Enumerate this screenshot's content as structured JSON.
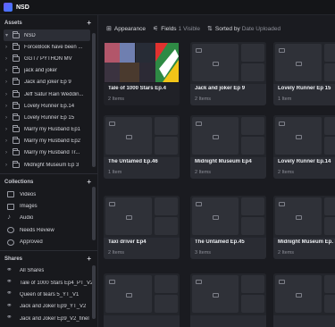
{
  "app": {
    "title": "NSD"
  },
  "assets": {
    "heading": "Assets",
    "items": [
      {
        "label": "NSD",
        "chevron": "▾",
        "active": true
      },
      {
        "label": "ForceBook have been ...",
        "chevron": "›"
      },
      {
        "label": "GGT7 PYTHON MV",
        "chevron": "›"
      },
      {
        "label": "jack and joker",
        "chevron": "›"
      },
      {
        "label": "Jack and joker Ep 9",
        "chevron": "›"
      },
      {
        "label": "Jeff Satur Rain Weddin...",
        "chevron": "›"
      },
      {
        "label": "Lovely Runner Ep.14",
        "chevron": "›"
      },
      {
        "label": "Lovely Runner Ep 15",
        "chevron": "›"
      },
      {
        "label": "Marry my Husband Ep1",
        "chevron": "›"
      },
      {
        "label": "Marry my Husband Ep2",
        "chevron": "›"
      },
      {
        "label": "Marry my Husband Tr...",
        "chevron": "›"
      },
      {
        "label": "Midnight Museum Ep 3",
        "chevron": "›"
      }
    ]
  },
  "collections": {
    "heading": "Collections",
    "items": [
      {
        "label": "Videos",
        "icon": "video-icon"
      },
      {
        "label": "Images",
        "icon": "image-icon"
      },
      {
        "label": "Audio",
        "icon": "audio-icon"
      },
      {
        "label": "Needs Review",
        "icon": "review-icon"
      },
      {
        "label": "Approved",
        "icon": "approved-icon"
      }
    ]
  },
  "shares": {
    "heading": "Shares",
    "items": [
      {
        "label": "All Shares"
      },
      {
        "label": "Tale of 1000 Stars Ep4_PT_V2"
      },
      {
        "label": "Queen of tears 5_YT_V1"
      },
      {
        "label": "Jack and Joker Ep9_YT_V2"
      },
      {
        "label": "Jack and Joker Ep9_V2_finel"
      }
    ]
  },
  "toolbar": {
    "appearance": "Appearance",
    "fields_label": "Fields",
    "fields_count": "1 Visible",
    "sorted_label": "Sorted by",
    "sorted_value": "Date Uploaded"
  },
  "cards": [
    {
      "name": "Tale of 1000 Stars Ep.4",
      "count": "2 Items",
      "kind": "image"
    },
    {
      "name": "Jack and joker Ep 9",
      "count": "2 Items",
      "kind": "folder"
    },
    {
      "name": "Lovely Runner Ep 15",
      "count": "1 Item",
      "kind": "folder"
    },
    {
      "name": "The Untamed Ep.46",
      "count": "1 Item",
      "kind": "folder"
    },
    {
      "name": "Midnight Museum Ep4",
      "count": "2 Items",
      "kind": "folder"
    },
    {
      "name": "Lovely Runner Ep.14",
      "count": "2 Items",
      "kind": "folder"
    },
    {
      "name": "Taxi driver Ep4",
      "count": "2 Items",
      "kind": "folder"
    },
    {
      "name": "The Untamed Ep.45",
      "count": "3 Items",
      "kind": "folder"
    },
    {
      "name": "Midnight Museum Ep. 3",
      "count": "2 Items",
      "kind": "folder"
    },
    {
      "name": "",
      "count": "",
      "kind": "folder"
    },
    {
      "name": "",
      "count": "",
      "kind": "folder"
    },
    {
      "name": "",
      "count": "",
      "kind": "folder"
    }
  ]
}
